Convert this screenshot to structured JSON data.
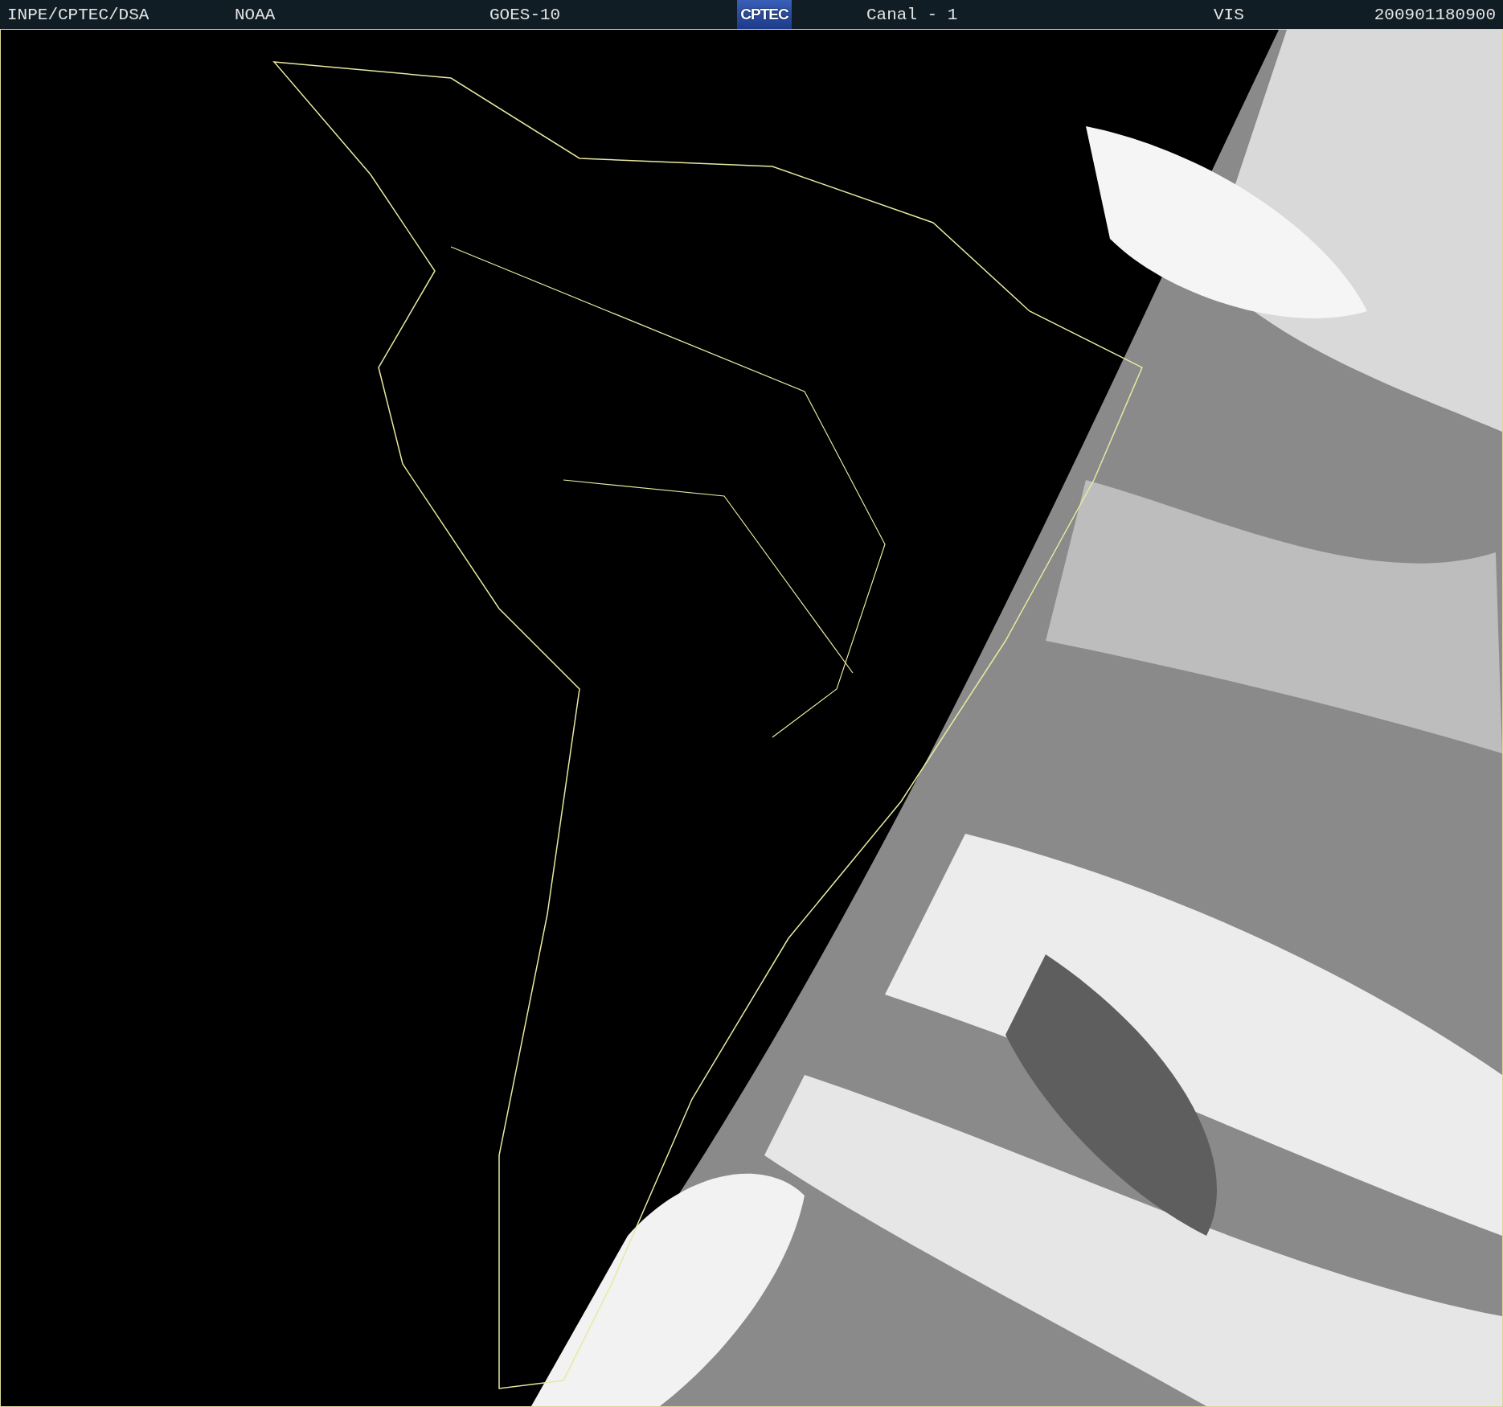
{
  "header": {
    "left": [
      {
        "text": "INPE/CPTEC/DSA"
      },
      {
        "text": "NOAA"
      },
      {
        "text": "GOES-10"
      }
    ],
    "logo": "CPTEC",
    "right": [
      {
        "text": "Canal - 1"
      },
      {
        "text": "VIS"
      },
      {
        "text": "200901180900"
      }
    ]
  }
}
